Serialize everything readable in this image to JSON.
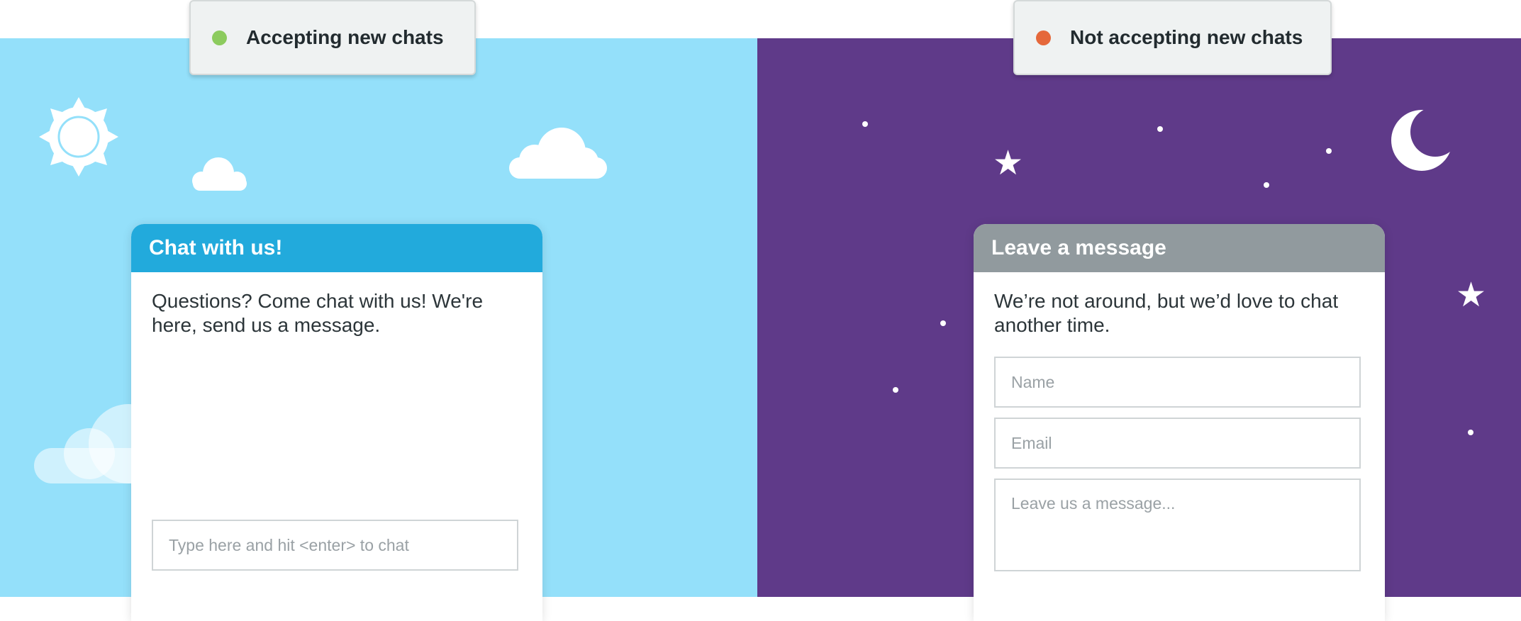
{
  "day_panel": {
    "status_label": "Accepting new chats",
    "status_color": "#8ccb5e",
    "background": "#94e0fa",
    "widget": {
      "title": "Chat with us!",
      "header_color": "#22aadc",
      "body_text": "Questions? Come chat with us! We're here, send us a message.",
      "input_placeholder": "Type here and hit <enter> to chat"
    },
    "decorations": [
      "sun-icon",
      "cloud-icon",
      "cloud-icon",
      "cloud-icon"
    ]
  },
  "night_panel": {
    "status_label": "Not accepting new chats",
    "status_color": "#e5683b",
    "background": "#5f3a89",
    "widget": {
      "title": "Leave a message",
      "header_color": "#919a9e",
      "body_text": "We’re not around, but we’d love to chat another time.",
      "name_placeholder": "Name",
      "email_placeholder": "Email",
      "message_placeholder": "Leave us a message..."
    },
    "decorations": [
      "moon-icon",
      "star-icon",
      "star-icon"
    ]
  }
}
